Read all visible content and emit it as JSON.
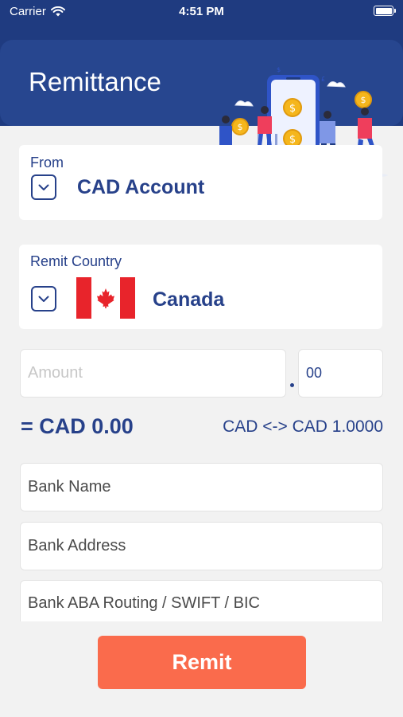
{
  "status_bar": {
    "carrier": "Carrier",
    "time": "4:51 PM"
  },
  "header": {
    "title": "Remittance"
  },
  "from_card": {
    "label": "From",
    "value": "CAD Account"
  },
  "country_card": {
    "label": "Remit Country",
    "value": "Canada"
  },
  "amount": {
    "placeholder": "Amount",
    "decimal_value": "00"
  },
  "conversion": {
    "converted": "= CAD 0.00",
    "rate": "CAD <-> CAD 1.0000"
  },
  "bank_fields": {
    "name_placeholder": "Bank Name",
    "address_placeholder": "Bank Address",
    "routing_placeholder": "Bank ABA Routing / SWIFT / BIC"
  },
  "actions": {
    "remit_label": "Remit"
  },
  "colors": {
    "header_bg": "#27468f",
    "primary_text": "#27418a",
    "button_bg": "#fa6b4c",
    "page_bg": "#f2f2f2"
  },
  "icons": [
    "wifi-icon",
    "battery-icon",
    "chevron-down-icon",
    "canada-flag-icon"
  ]
}
